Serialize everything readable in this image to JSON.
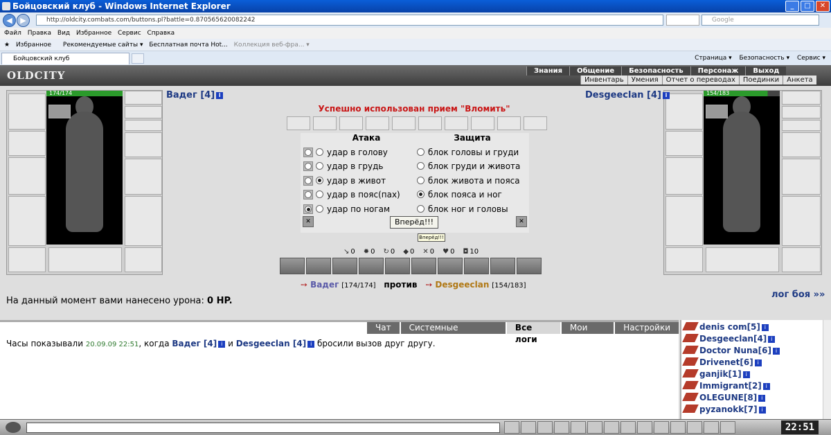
{
  "window": {
    "title": "Бойцовский клуб - Windows Internet Explorer",
    "address": "http://oldcity.combats.com/buttons.pl?battle=0.870565620082242",
    "search_placeholder": "Google"
  },
  "menu": [
    "Файл",
    "Правка",
    "Вид",
    "Избранное",
    "Сервис",
    "Справка"
  ],
  "favorites": {
    "label": "Избранное",
    "items": [
      "Рекомендуемые сайты ▾",
      "Бесплатная почта Hot...",
      "Коллекция веб-фра... ▾"
    ]
  },
  "tab": {
    "label": "Бойцовский клуб"
  },
  "browser_tools": [
    "Страница ▾",
    "Безопасность ▾",
    "Сервис ▾"
  ],
  "game": {
    "logo": "OLDCITY",
    "nav_top": [
      "Знания",
      "Общение",
      "Безопасность",
      "Персонаж",
      "Выход"
    ],
    "nav_bottom": [
      "Инвентарь",
      "Умения",
      "Отчет о переводах",
      "Поединки",
      "Анкета"
    ],
    "player": {
      "name": "Вадег [4]",
      "hp": "174/174",
      "hp_fraction": 1.0
    },
    "enemy": {
      "name": "Desgeeclan [4]",
      "hp": "154/183",
      "hp_fraction": 0.84
    },
    "status": "Успешно использован прием \"Вломить\"",
    "attack_title": "Атака",
    "defense_title": "Защита",
    "attacks": [
      "удар в голову",
      "удар в грудь",
      "удар в живот",
      "удар в пояс(пах)",
      "удар по ногам"
    ],
    "defenses": [
      "блок головы и груди",
      "блок груди и живота",
      "блок живота и пояса",
      "блок пояса и ног",
      "блок ног и головы"
    ],
    "go_button": "Вперёд!!!",
    "tooltip": "Вперёд!!!",
    "stats": [
      "0",
      "0",
      "0",
      "0",
      "0",
      "0",
      "10"
    ],
    "vs": {
      "p1": "Вадег",
      "p1hp": "[174/174]",
      "word": "против",
      "p2": "Desgeeclan",
      "p2hp": "[154/183]"
    },
    "damage": {
      "prefix": "На данный момент вами нанесено урона:",
      "value": "0 HP."
    },
    "log_link": "лог боя »»"
  },
  "chat": {
    "tabs": [
      "Чат",
      "Системные сообщения",
      "Все логи",
      "Мои логи",
      "Настройки"
    ],
    "message": {
      "p1": "Часы показывали",
      "time": "20.09.09 22:51",
      "p2": ", когда",
      "n1": "Вадег [4]",
      "p3": "и",
      "n2": "Desgeeclan [4]",
      "p4": "бросили вызов друг другу."
    }
  },
  "online": [
    "denis com[5]",
    "Desgeeclan[4]",
    "Doctor Nuna[6]",
    "Drivenet[6]",
    "ganjik[1]",
    "Immigrant[2]",
    "OLEGUNE[8]",
    "pyzanokk[7]"
  ],
  "clock": "22:51"
}
